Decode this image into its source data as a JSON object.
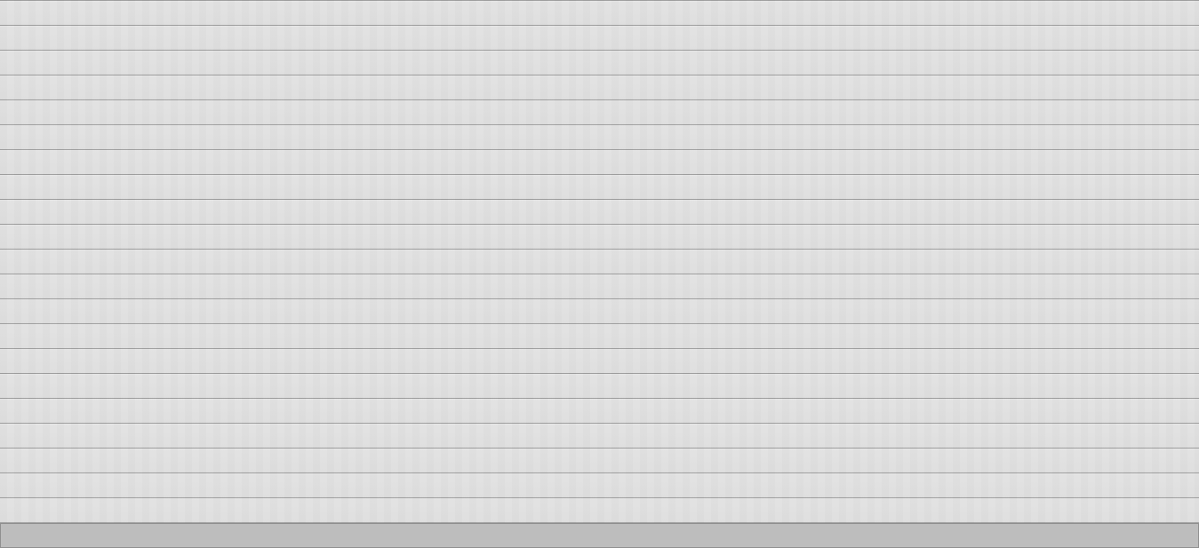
{
  "screen": {
    "background_color": "#f0f0f0",
    "stripe_line_color": "#a9a9a9",
    "bottom_bar_color": "#bdbdbd",
    "bottom_bar_border_color": "#8f8f8f"
  },
  "bottom_bar": {
    "label": ""
  }
}
